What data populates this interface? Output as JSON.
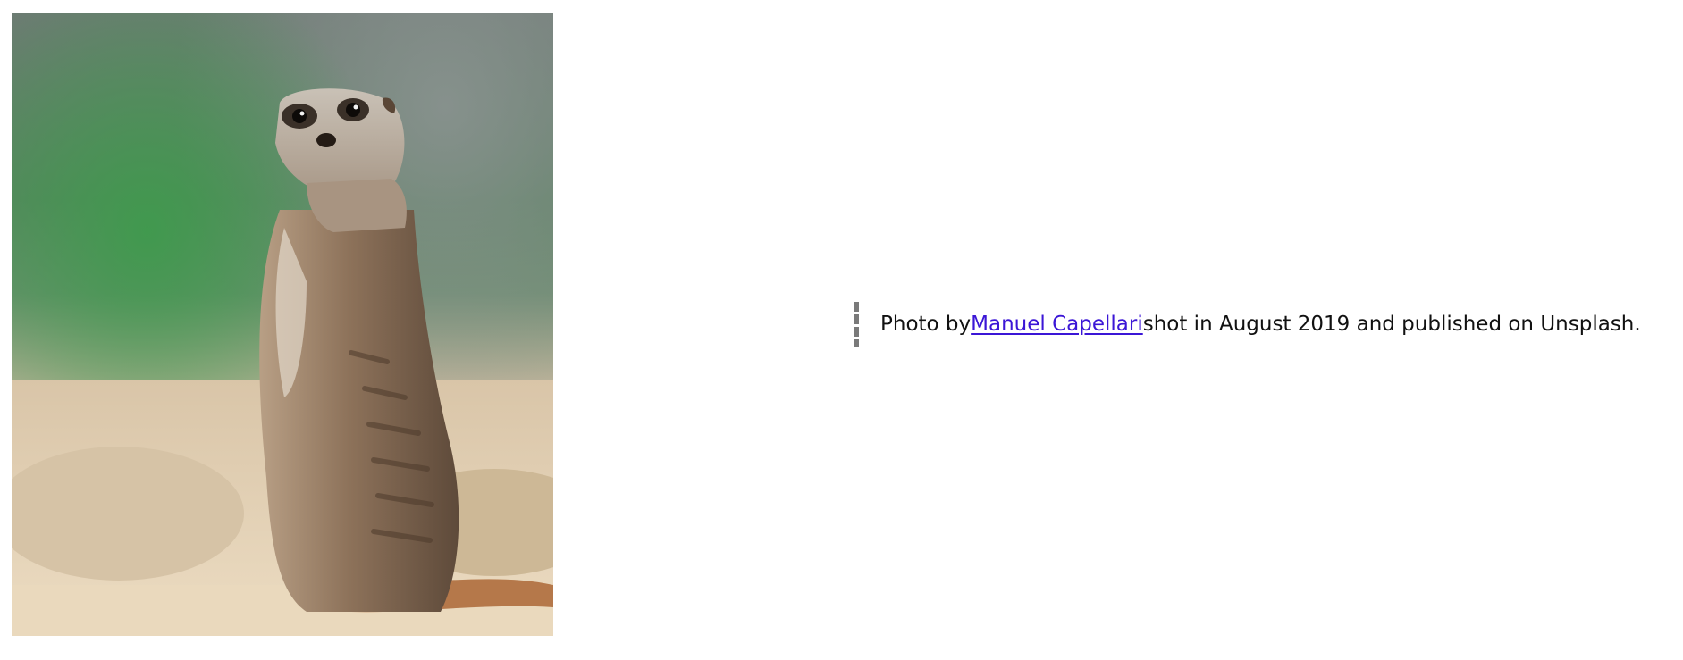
{
  "photo": {
    "subject": "meerkat-photo",
    "colors": {
      "background_top": "#6f7a75",
      "foliage": "#4f9a5a",
      "sand": "#e5d4b8",
      "fur": "#9a8068"
    }
  },
  "caption": {
    "prefix": "Photo by ",
    "author_link": "Manuel Capellari",
    "suffix": " shot in August 2019 and published on Unsplash.",
    "link_color": "#3b16d6"
  }
}
